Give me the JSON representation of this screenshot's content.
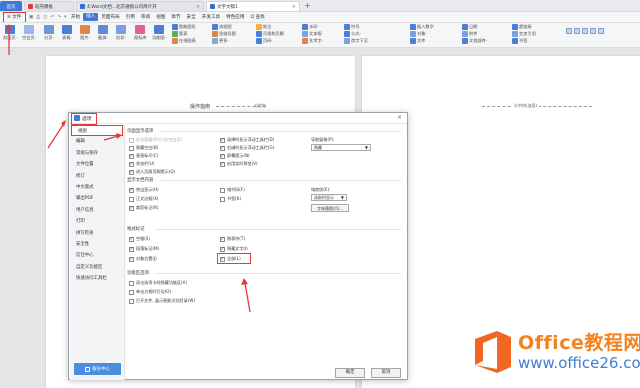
{
  "tabs": {
    "home": "首页",
    "items": [
      {
        "label": "稻壳模板",
        "icon_color": "#e53935"
      },
      {
        "label": "4.Word文档...北京通锁公司简介开",
        "icon_color": "#2f6fd4"
      },
      {
        "label": "文字文稿1",
        "icon_color": "#2f6fd4",
        "active": true
      }
    ],
    "new_tab": "+"
  },
  "menu": {
    "file": "≡ 文件",
    "items": [
      "开始",
      "插入",
      "页面布局",
      "引用",
      "审阅",
      "视图",
      "章节",
      "安全",
      "开发工具",
      "特色应用"
    ],
    "active_index": 1,
    "search": "Q 查找"
  },
  "ribbon": {
    "groups": [
      {
        "label": "封面页·",
        "color": "#4a7fd4"
      },
      {
        "label": "空白页·",
        "color": "#4a7fd4"
      },
      {
        "label": "分页·",
        "color": "#4a7fd4"
      },
      {
        "label": "表格·",
        "color": "#4a7fd4"
      },
      {
        "label": "图片·",
        "color": "#e0854a"
      },
      {
        "label": "截屏·",
        "color": "#4a7fd4"
      },
      {
        "label": "形状·",
        "color": "#4a7fd4"
      },
      {
        "label": "图标库",
        "color": "#e85d9a"
      },
      {
        "label": "功能图·",
        "color": "#4a7fd4"
      }
    ],
    "small_groups": [
      [
        "智能图形",
        "图表",
        "在线图表"
      ],
      [
        "流程图",
        "思维导图",
        "更多·"
      ],
      [
        "批注",
        "页眉和页脚",
        "页码·"
      ],
      [
        "水印·",
        "文本框·",
        "艺术字·"
      ],
      [
        "符号·",
        "公式·",
        "首字下沉"
      ],
      [
        "插入数字",
        "对象·",
        "文件"
      ],
      [
        "日期",
        "附件",
        "文档部件·"
      ],
      [
        "超链接",
        "交叉引用",
        "书签"
      ]
    ]
  },
  "document": {
    "left_header": "操作指南",
    "left_header_right": "分栏符",
    "right_header": "分节符(连续)"
  },
  "dialog": {
    "title": "选项",
    "close": "×",
    "sidebar": [
      "视图",
      "编辑",
      "常规与保存",
      "文件位置",
      "修订",
      "中文版式",
      "输出PDF",
      "用户信息",
      "打印",
      "拼写检查",
      "安全性",
      "信任中心",
      "自定义功能区",
      "快速访问工具栏"
    ],
    "selected_index": 0,
    "backup_label": "备份中心",
    "sections": {
      "page": {
        "title": "页面显示选项",
        "checks_left": [
          {
            "label": "任务窗格(R)(只在空白页)",
            "checked": false,
            "disabled": true
          },
          {
            "label": "隐藏空白(B)",
            "checked": false
          },
          {
            "label": "垂直标尺(C)",
            "checked": true
          },
          {
            "label": "状态栏(U)",
            "checked": true
          },
          {
            "label": "进入页眉页脚提示(Q)",
            "checked": true
          }
        ],
        "checks_mid": [
          {
            "label": "选择时显示浮动工具栏(D)",
            "checked": true
          },
          {
            "label": "右键时显示浮动工具栏(G)",
            "checked": true
          },
          {
            "label": "屏幕提示(N)",
            "checked": true
          },
          {
            "label": "启用实时预览(V)",
            "checked": true
          }
        ],
        "nav_label": "导航窗格(P):",
        "nav_value": "隐藏",
        "nav_arrow": "▼"
      },
      "format": {
        "title": "显示文档内容",
        "checks_left": [
          {
            "label": "突出显示(H)",
            "checked": true
          },
          {
            "label": "正文边框(X)",
            "checked": false
          },
          {
            "label": "裁剪标记(R)",
            "checked": true
          }
        ],
        "checks_mid": [
          {
            "label": "域代码(F)",
            "checked": false
          },
          {
            "label": "书签(K)",
            "checked": false
          }
        ],
        "field_label": "域底纹(E):",
        "field_value": "选取时显示",
        "field_arrow": "▼",
        "font_button": "字体替换(O)..."
      },
      "marks": {
        "title": "格式标记",
        "checks_left": [
          {
            "label": "空格(S)",
            "checked": true
          },
          {
            "label": "段落标记(M)",
            "checked": true
          },
          {
            "label": "对象位置(J)",
            "checked": true
          }
        ],
        "checks_mid": [
          {
            "label": "制表符(T)",
            "checked": true
          },
          {
            "label": "隐藏文字(I)",
            "checked": true
          },
          {
            "label": "全部(L)",
            "checked": true
          }
        ]
      },
      "func": {
        "title": "功能区选项",
        "checks": [
          {
            "label": "双击选项卡时隐藏功能区(A)",
            "checked": false
          },
          {
            "label": "单击方框时打勾(O)",
            "checked": false
          },
          {
            "label": "打开文件, 展示智能识别目录(W)",
            "checked": false
          }
        ]
      }
    },
    "ok": "确定",
    "cancel": "取消"
  },
  "watermark": {
    "line1": "Office教程网",
    "line2": "www.office26.com"
  },
  "colors": {
    "accent": "#3f7ad8",
    "highlight": "#e53935",
    "watermark_orange": "#f58220",
    "watermark_blue": "#3d7dd8"
  }
}
